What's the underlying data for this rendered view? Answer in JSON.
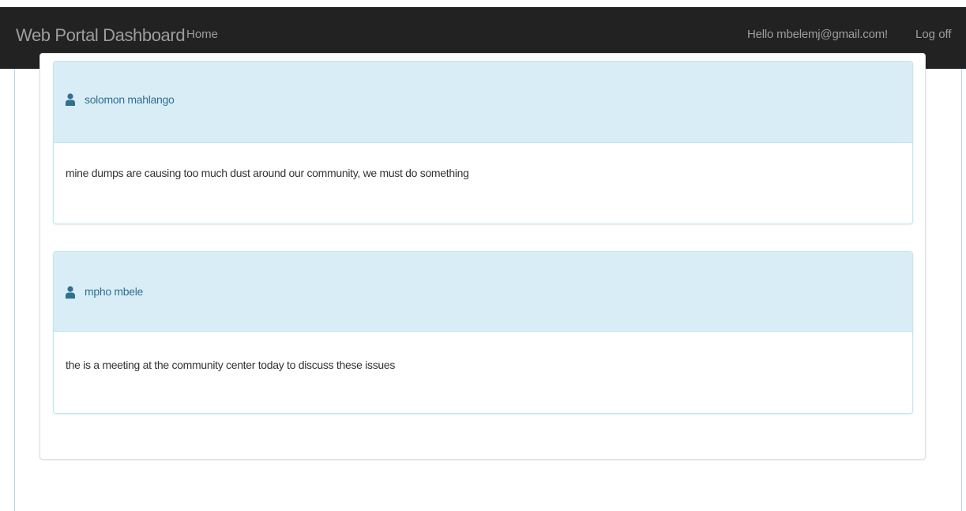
{
  "navbar": {
    "brand": "Web Portal Dashboard",
    "home_label": "Home",
    "greeting": "Hello mbelemj@gmail.com!",
    "logoff_label": "Log off"
  },
  "posts": [
    {
      "author": "solomon mahlango",
      "message": "mine dumps are causing too much dust around our community, we must do something"
    },
    {
      "author": "mpho mbele",
      "message": "the is a meeting at the community center today to discuss these issues"
    }
  ],
  "icons": {
    "author": "user-icon"
  },
  "colors": {
    "navbar_bg": "#222222",
    "navbar_text": "#9d9d9d",
    "panel_heading_bg": "#d9edf7",
    "panel_border": "#bce8f1",
    "author_text": "#31708f",
    "body_text": "#333333"
  }
}
